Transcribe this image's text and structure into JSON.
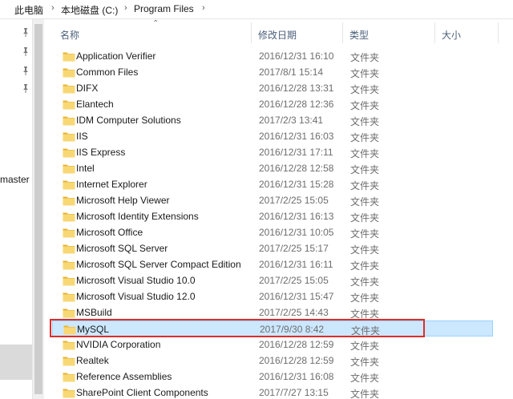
{
  "breadcrumb": [
    "此电脑",
    "本地磁盘 (C:)",
    "Program Files"
  ],
  "nav": {
    "label": "master"
  },
  "columns": {
    "name": "名称",
    "modified": "修改日期",
    "type": "类型",
    "size": "大小"
  },
  "files": [
    {
      "name": "Application Verifier",
      "modified": "2016/12/31 16:10",
      "type": "文件夹"
    },
    {
      "name": "Common Files",
      "modified": "2017/8/1 15:14",
      "type": "文件夹"
    },
    {
      "name": "DIFX",
      "modified": "2016/12/28 13:31",
      "type": "文件夹"
    },
    {
      "name": "Elantech",
      "modified": "2016/12/28 12:36",
      "type": "文件夹"
    },
    {
      "name": "IDM Computer Solutions",
      "modified": "2017/2/3 13:41",
      "type": "文件夹"
    },
    {
      "name": "IIS",
      "modified": "2016/12/31 16:03",
      "type": "文件夹"
    },
    {
      "name": "IIS Express",
      "modified": "2016/12/31 17:11",
      "type": "文件夹"
    },
    {
      "name": "Intel",
      "modified": "2016/12/28 12:58",
      "type": "文件夹"
    },
    {
      "name": "Internet Explorer",
      "modified": "2016/12/31 15:28",
      "type": "文件夹"
    },
    {
      "name": "Microsoft Help Viewer",
      "modified": "2017/2/25 15:05",
      "type": "文件夹"
    },
    {
      "name": "Microsoft Identity Extensions",
      "modified": "2016/12/31 16:13",
      "type": "文件夹"
    },
    {
      "name": "Microsoft Office",
      "modified": "2016/12/31 10:05",
      "type": "文件夹"
    },
    {
      "name": "Microsoft SQL Server",
      "modified": "2017/2/25 15:17",
      "type": "文件夹"
    },
    {
      "name": "Microsoft SQL Server Compact Edition",
      "modified": "2016/12/31 16:11",
      "type": "文件夹"
    },
    {
      "name": "Microsoft Visual Studio 10.0",
      "modified": "2017/2/25 15:05",
      "type": "文件夹"
    },
    {
      "name": "Microsoft Visual Studio 12.0",
      "modified": "2016/12/31 15:47",
      "type": "文件夹"
    },
    {
      "name": "MSBuild",
      "modified": "2017/2/25 14:43",
      "type": "文件夹"
    },
    {
      "name": "MySQL",
      "modified": "2017/9/30 8:42",
      "type": "文件夹",
      "selected": true
    },
    {
      "name": "NVIDIA Corporation",
      "modified": "2016/12/28 12:59",
      "type": "文件夹"
    },
    {
      "name": "Realtek",
      "modified": "2016/12/28 12:59",
      "type": "文件夹"
    },
    {
      "name": "Reference Assemblies",
      "modified": "2016/12/31 16:08",
      "type": "文件夹"
    },
    {
      "name": "SharePoint Client Components",
      "modified": "2017/7/27 13:15",
      "type": "文件夹"
    }
  ],
  "colors": {
    "folder": "#f5c842",
    "selection": "#cce8ff",
    "highlight": "#e02b2b"
  },
  "icons": {
    "folder": "folder-icon",
    "pin": "pin-icon",
    "sort": "sort-up-icon",
    "chevron": "chevron-right-icon"
  }
}
